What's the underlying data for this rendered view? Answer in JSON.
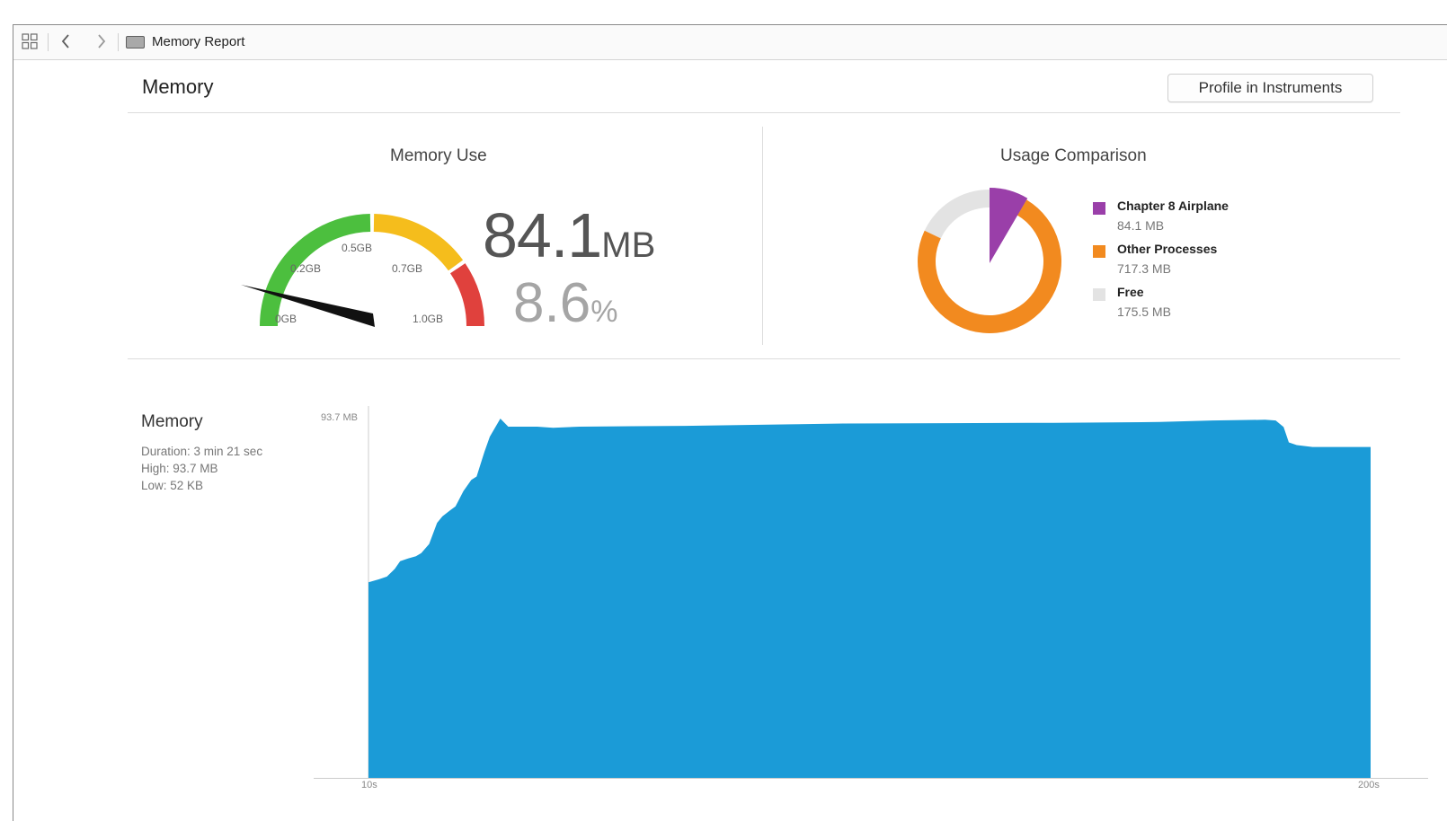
{
  "toolbar": {
    "grid_icon": "grid-icon",
    "back_icon": "chevron-left-icon",
    "forward_icon": "chevron-right-icon",
    "doc_icon": "report-icon",
    "title": "Memory Report"
  },
  "header": {
    "title": "Memory",
    "profile_button": "Profile in Instruments"
  },
  "memory_use": {
    "title": "Memory Use",
    "gauge_labels": [
      "0GB",
      "0.2GB",
      "0.5GB",
      "0.7GB",
      "1.0GB"
    ],
    "gauge_min_gb": 0,
    "gauge_max_gb": 1.0,
    "needle_gb": 0.0841,
    "zone_colors": [
      "#4cbf3e",
      "#f5bd1c",
      "#e0413d"
    ],
    "value_num": "84.1",
    "value_unit": "MB",
    "percent_num": "8.6",
    "percent_unit": "%"
  },
  "usage_comparison": {
    "title": "Usage Comparison",
    "items": [
      {
        "name": "Chapter 8 Airplane",
        "value": "84.1 MB",
        "mb": 84.1,
        "color": "#9a3fa9"
      },
      {
        "name": "Other Processes",
        "value": "717.3 MB",
        "mb": 717.3,
        "color": "#f28a1f"
      },
      {
        "name": "Free",
        "value": "175.5 MB",
        "mb": 175.5,
        "color": "#e3e3e3"
      }
    ]
  },
  "memory_timeline": {
    "title": "Memory",
    "duration": "Duration: 3 min 21 sec",
    "high": "High: 93.7 MB",
    "low": "Low: 52 KB"
  },
  "chart_data": {
    "type": "area",
    "title": "",
    "xlabel": "",
    "ylabel": "",
    "y_max_label": "93.7 MB",
    "x_tick_labels": [
      "10s",
      "200s"
    ],
    "xlim": [
      10,
      200
    ],
    "ylim": [
      0,
      93.7
    ],
    "color": "#1b9bd7",
    "x": [
      10,
      12,
      13.5,
      15,
      16,
      17.5,
      19,
      20,
      21.5,
      23,
      24,
      25.5,
      26.5,
      28,
      29.5,
      30.5,
      32,
      33,
      35,
      36.5,
      38,
      40,
      42,
      45,
      50,
      60,
      70,
      80,
      90,
      100,
      120,
      140,
      160,
      170,
      180,
      182,
      183.5,
      184.5,
      186,
      189,
      195,
      200
    ],
    "y": [
      51,
      51.8,
      52.5,
      54.5,
      56.5,
      57.2,
      57.8,
      58.6,
      61,
      66.5,
      68.2,
      69.8,
      70.8,
      74.8,
      77.7,
      78.6,
      85.1,
      89,
      93.7,
      91.6,
      91.6,
      91.6,
      91.6,
      91.3,
      91.6,
      91.7,
      91.8,
      92.0,
      92.2,
      92.4,
      92.5,
      92.6,
      92.8,
      93.2,
      93.4,
      93.2,
      91.5,
      87.5,
      86.8,
      86.3,
      86.3,
      86.3
    ]
  }
}
